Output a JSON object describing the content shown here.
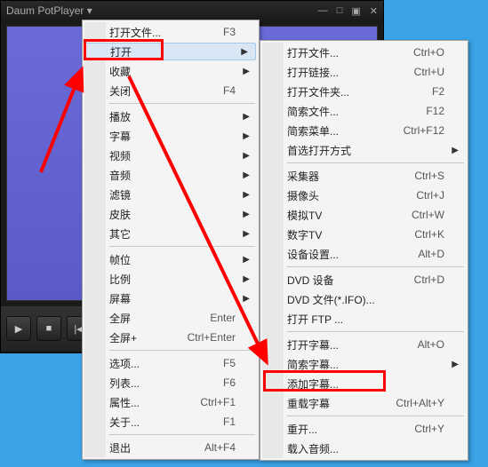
{
  "titlebar": {
    "title": "Daum PotPlayer ▾"
  },
  "menu1": [
    {
      "label": "打开文件...",
      "shortcut": "F3",
      "sub": false
    },
    {
      "label": "打开",
      "shortcut": "",
      "sub": true,
      "highlight": true
    },
    {
      "label": "收藏",
      "shortcut": "",
      "sub": true
    },
    {
      "label": "关闭",
      "shortcut": "F4",
      "sub": false
    },
    {
      "sep": true
    },
    {
      "label": "播放",
      "shortcut": "",
      "sub": true
    },
    {
      "label": "字幕",
      "shortcut": "",
      "sub": true
    },
    {
      "label": "视频",
      "shortcut": "",
      "sub": true
    },
    {
      "label": "音频",
      "shortcut": "",
      "sub": true
    },
    {
      "label": "滤镜",
      "shortcut": "",
      "sub": true
    },
    {
      "label": "皮肤",
      "shortcut": "",
      "sub": true
    },
    {
      "label": "其它",
      "shortcut": "",
      "sub": true
    },
    {
      "sep": true
    },
    {
      "label": "帧位",
      "shortcut": "",
      "sub": true
    },
    {
      "label": "比例",
      "shortcut": "",
      "sub": true
    },
    {
      "label": "屏幕",
      "shortcut": "",
      "sub": true
    },
    {
      "label": "全屏",
      "shortcut": "Enter",
      "sub": false
    },
    {
      "label": "全屏+",
      "shortcut": "Ctrl+Enter",
      "sub": false
    },
    {
      "sep": true
    },
    {
      "label": "选项...",
      "shortcut": "F5",
      "sub": false
    },
    {
      "label": "列表...",
      "shortcut": "F6",
      "sub": false
    },
    {
      "label": "属性...",
      "shortcut": "Ctrl+F1",
      "sub": false
    },
    {
      "label": "关于...",
      "shortcut": "F1",
      "sub": false
    },
    {
      "sep": true
    },
    {
      "label": "退出",
      "shortcut": "Alt+F4",
      "sub": false
    }
  ],
  "menu2": [
    {
      "label": "打开文件...",
      "shortcut": "Ctrl+O",
      "sub": false
    },
    {
      "label": "打开链接...",
      "shortcut": "Ctrl+U",
      "sub": false
    },
    {
      "label": "打开文件夹...",
      "shortcut": "F2",
      "sub": false
    },
    {
      "label": "简索文件...",
      "shortcut": "F12",
      "sub": false
    },
    {
      "label": "简索菜单...",
      "shortcut": "Ctrl+F12",
      "sub": false
    },
    {
      "label": "首选打开方式",
      "shortcut": "",
      "sub": true
    },
    {
      "sep": true
    },
    {
      "label": "采集器",
      "shortcut": "Ctrl+S",
      "sub": false
    },
    {
      "label": "摄像头",
      "shortcut": "Ctrl+J",
      "sub": false
    },
    {
      "label": "模拟TV",
      "shortcut": "Ctrl+W",
      "sub": false
    },
    {
      "label": "数字TV",
      "shortcut": "Ctrl+K",
      "sub": false
    },
    {
      "label": "设备设置...",
      "shortcut": "Alt+D",
      "sub": false
    },
    {
      "sep": true
    },
    {
      "label": "DVD 设备",
      "shortcut": "Ctrl+D",
      "sub": false
    },
    {
      "label": "DVD 文件(*.IFO)...",
      "shortcut": "",
      "sub": false
    },
    {
      "label": "打开 FTP ...",
      "shortcut": "",
      "sub": false
    },
    {
      "sep": true
    },
    {
      "label": "打开字幕...",
      "shortcut": "Alt+O",
      "sub": false
    },
    {
      "label": "简索字幕...",
      "shortcut": "",
      "sub": true
    },
    {
      "label": "添加字幕...",
      "shortcut": "",
      "sub": false
    },
    {
      "label": "重载字幕",
      "shortcut": "Ctrl+Alt+Y",
      "sub": false
    },
    {
      "sep": true
    },
    {
      "label": "重开...",
      "shortcut": "Ctrl+Y",
      "sub": false
    },
    {
      "label": "载入音频...",
      "shortcut": "",
      "sub": false
    }
  ]
}
